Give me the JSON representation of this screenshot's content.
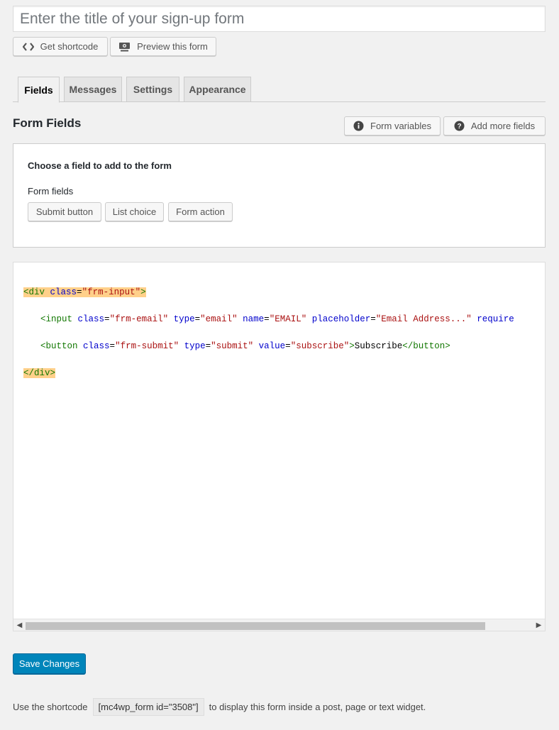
{
  "title_input": {
    "placeholder": "Enter the title of your sign-up form",
    "value": ""
  },
  "toolbar": {
    "shortcode_label": "Get shortcode",
    "preview_label": "Preview this form"
  },
  "tabs": [
    {
      "label": "Fields",
      "active": true
    },
    {
      "label": "Messages",
      "active": false
    },
    {
      "label": "Settings",
      "active": false
    },
    {
      "label": "Appearance",
      "active": false
    }
  ],
  "section": {
    "title": "Form Fields",
    "form_variables_label": "Form variables",
    "add_more_fields_label": "Add more fields"
  },
  "field_panel": {
    "heading": "Choose a field to add to the form",
    "subheading": "Form fields",
    "buttons": [
      "Submit button",
      "List choice",
      "Form action"
    ]
  },
  "editor": {
    "line1": {
      "tag_open": "<div",
      "attr": "class",
      "value": "\"frm-input\"",
      "close": ">"
    },
    "line2": {
      "tag": "<input",
      "a1": "class",
      "v1": "\"frm-email\"",
      "a2": "type",
      "v2": "\"email\"",
      "a3": "name",
      "v3": "\"EMAIL\"",
      "a4": "placeholder",
      "v4": "\"Email Address...\"",
      "a5": "require"
    },
    "line3": {
      "tag": "<button",
      "a1": "class",
      "v1": "\"frm-submit\"",
      "a2": "type",
      "v2": "\"submit\"",
      "a3": "value",
      "v3": "\"subscribe\"",
      "close": ">",
      "text": "Subscribe",
      "end": "</button>"
    },
    "line4": {
      "end": "</div>"
    }
  },
  "save_label": "Save Changes",
  "footer": {
    "prefix": "Use the shortcode",
    "shortcode": "[mc4wp_form id=\"3508\"]",
    "suffix": "to display this form inside a post, page or text widget."
  },
  "colors": {
    "primary": "#0085ba",
    "tag": "#117700",
    "attribute": "#0000cc",
    "string": "#aa1111",
    "highlight": "#ffd08a"
  }
}
